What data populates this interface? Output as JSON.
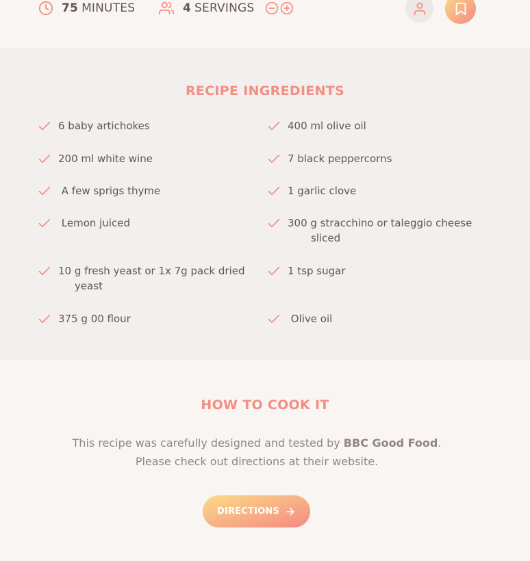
{
  "recipe_info": {
    "duration_value": "75",
    "duration_unit": "MINUTES",
    "servings_value": "4",
    "servings_unit": "SERVINGS"
  },
  "ingredients": {
    "heading": "RECIPE INGREDIENTS",
    "left": [
      "6 baby artichokes",
      "200 ml white wine",
      " A few sprigs thyme",
      " Lemon juiced",
      "10 g fresh yeast or 1x 7g pack dried",
      "375 g 00 flour"
    ],
    "left_wrap": {
      "4": "yeast"
    },
    "right": [
      "400 ml olive oil",
      "7 black peppercorns",
      "1 garlic clove",
      "300 g stracchino or taleggio cheese",
      "1 tsp sugar",
      " Olive oil"
    ],
    "right_wrap": {
      "3": "sliced"
    }
  },
  "cook": {
    "heading": "HOW TO COOK IT",
    "text_before": "This recipe was carefully designed and tested by ",
    "publisher": "BBC Good Food",
    "text_after": ". Please check out directions at their website.",
    "button_label": "DIRECTIONS"
  },
  "colors": {
    "accent": "#f38e82",
    "gradient_start": "#fbdb89",
    "gradient_end": "#f48982",
    "text": "#615551",
    "muted_text": "#918581"
  },
  "icons": [
    "clock-icon",
    "users-icon",
    "minus-circle-icon",
    "plus-circle-icon",
    "user-icon",
    "bookmark-icon",
    "check-icon",
    "arrow-right-icon"
  ]
}
